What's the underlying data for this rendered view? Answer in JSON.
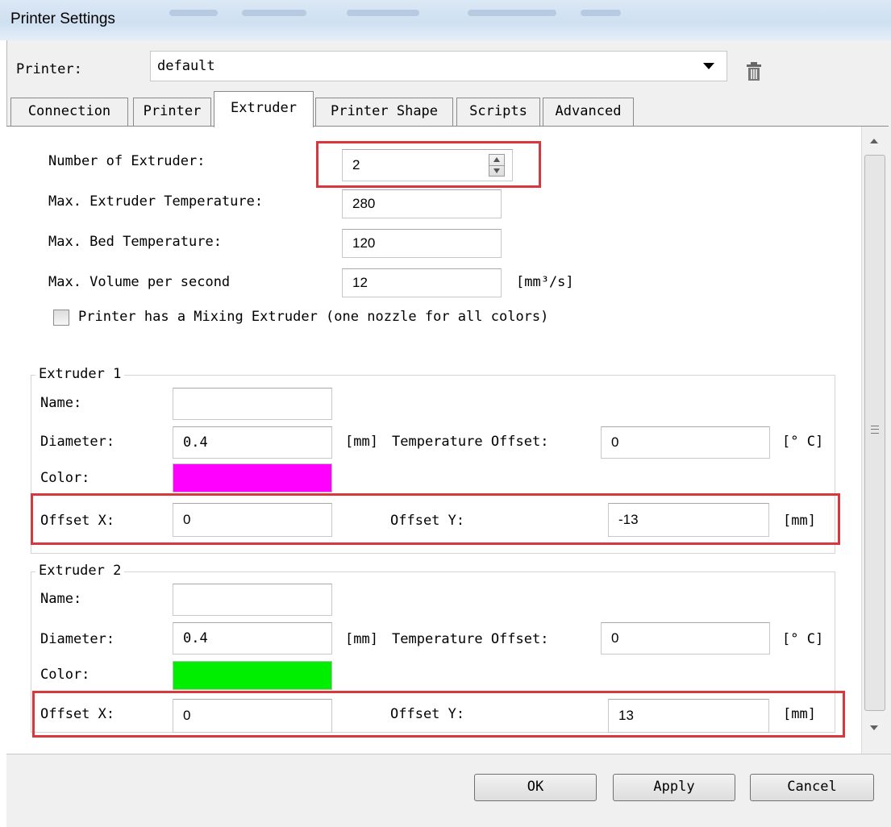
{
  "window": {
    "title": "Printer Settings"
  },
  "printer": {
    "label": "Printer:",
    "selected": "default"
  },
  "tabs": [
    {
      "label": "Connection"
    },
    {
      "label": "Printer"
    },
    {
      "label": "Extruder"
    },
    {
      "label": "Printer Shape"
    },
    {
      "label": "Scripts"
    },
    {
      "label": "Advanced"
    }
  ],
  "general": {
    "num_extruders_label": "Number of Extruder:",
    "num_extruders_value": "2",
    "max_extruder_temp_label": "Max. Extruder Temperature:",
    "max_extruder_temp_value": "280",
    "max_bed_temp_label": "Max. Bed Temperature:",
    "max_bed_temp_value": "120",
    "max_volume_label": "Max. Volume per second",
    "max_volume_value": "12",
    "max_volume_unit": "[mm³/s]",
    "mixing_extruder_label": "Printer has a Mixing Extruder (one nozzle for all colors)"
  },
  "extruders": [
    {
      "title": "Extruder 1",
      "name_label": "Name:",
      "name_value": "",
      "diameter_label": "Diameter:",
      "diameter_value": "0.4",
      "diameter_unit": "[mm]",
      "temp_offset_label": "Temperature Offset:",
      "temp_offset_value": "0",
      "temp_offset_unit": "[° C]",
      "color_label": "Color:",
      "color": "#ff00ff",
      "offset_x_label": "Offset X:",
      "offset_x_value": "0",
      "offset_y_label": "Offset Y:",
      "offset_y_value": "-13",
      "offset_unit": "[mm]"
    },
    {
      "title": "Extruder 2",
      "name_label": "Name:",
      "name_value": "",
      "diameter_label": "Diameter:",
      "diameter_value": "0.4",
      "diameter_unit": "[mm]",
      "temp_offset_label": "Temperature Offset:",
      "temp_offset_value": "0",
      "temp_offset_unit": "[° C]",
      "color_label": "Color:",
      "color": "#00ee00",
      "offset_x_label": "Offset X:",
      "offset_x_value": "0",
      "offset_y_label": "Offset Y:",
      "offset_y_value": "13",
      "offset_unit": "[mm]"
    }
  ],
  "buttons": {
    "ok": "OK",
    "apply": "Apply",
    "cancel": "Cancel"
  },
  "colors": {
    "highlight": "#d9373b"
  }
}
